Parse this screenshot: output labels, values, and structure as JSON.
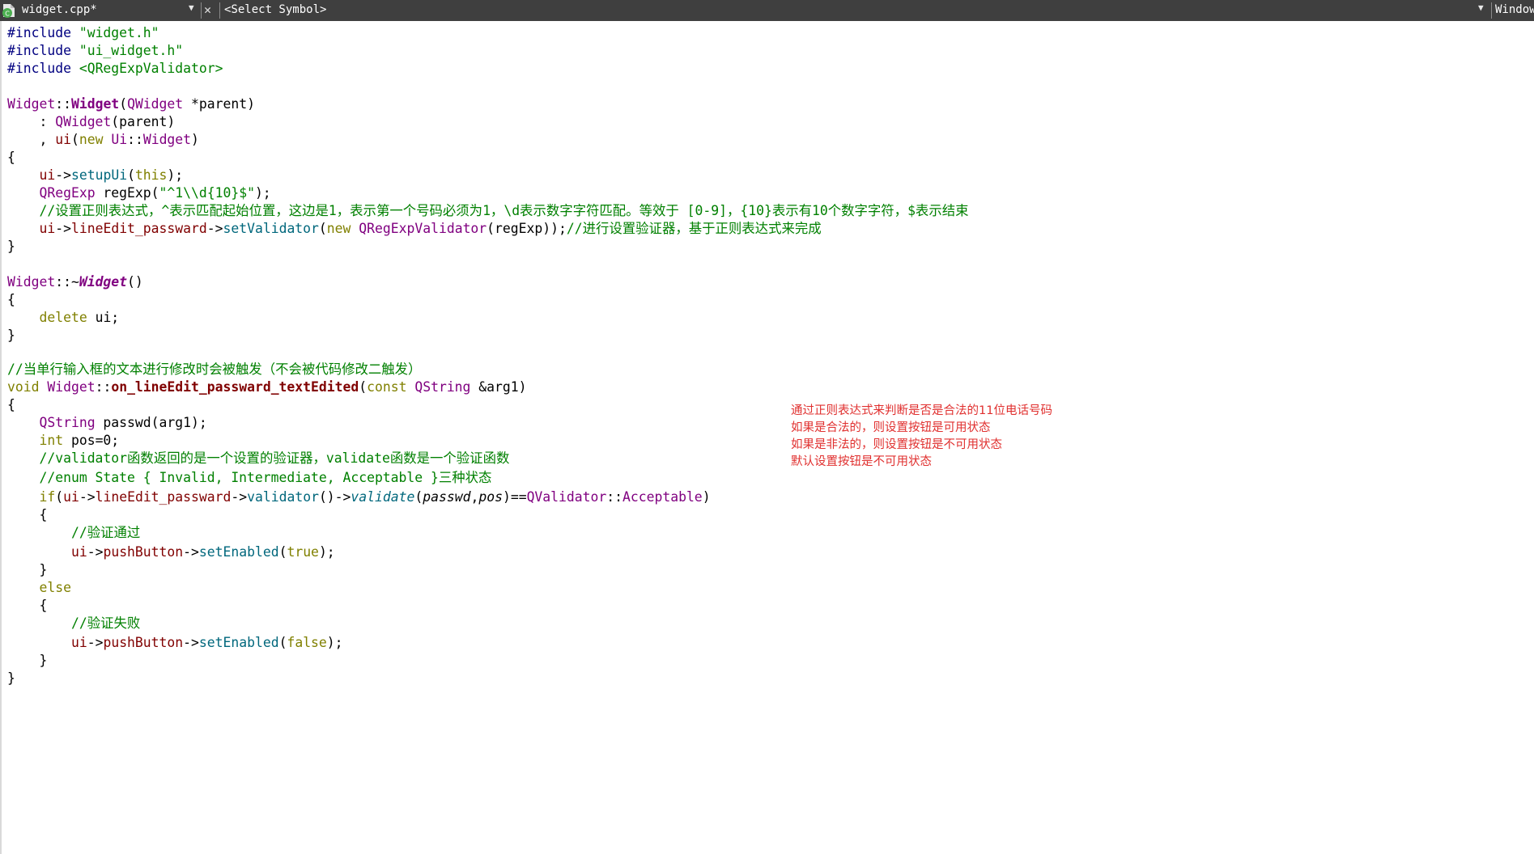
{
  "toolbar": {
    "file_name": "widget.cpp*",
    "symbol": "<Select Symbol>",
    "window_label": "Window"
  },
  "code": {
    "l1": {
      "directive": "#include",
      "file": "\"widget.h\""
    },
    "l2": {
      "directive": "#include",
      "file": "\"ui_widget.h\""
    },
    "l3": {
      "directive": "#include",
      "file": "<QRegExpValidator>"
    },
    "l5": {
      "class1": "Widget",
      "scope": "::",
      "ctor": "Widget",
      "open": "(",
      "ptype": "QWidget",
      "param": " *parent",
      "close": ")"
    },
    "l6": {
      "indent": "    : ",
      "base": "QWidget",
      "args": "(parent)"
    },
    "l7": {
      "indent": "    , ",
      "member": "ui",
      "open": "(",
      "kw_new": "new",
      "ns": "Ui",
      "scope": "::",
      "cls": "Widget",
      "close": ")"
    },
    "l8": {
      "text": "{"
    },
    "l9": {
      "indent": "    ",
      "ui": "ui",
      "arrow": "->",
      "fn": "setupUi",
      "open": "(",
      "kw_this": "this",
      "close": ");"
    },
    "l10": {
      "indent": "    ",
      "type": "QRegExp",
      "var": " regExp(",
      "string": "\"^1\\\\d{10}$\"",
      "close": ");"
    },
    "l11": {
      "indent": "    ",
      "comment": "//设置正则表达式，^表示匹配起始位置，这边是1，表示第一个号码必须为1，\\d表示数字字符匹配。等效于 [0-9]，{10}表示有10个数字字符，$表示结束"
    },
    "l12": {
      "indent": "    ",
      "ui": "ui",
      "arrow": "->",
      "member": "lineEdit_passward",
      "arrow2": "->",
      "fn": "setValidator",
      "open": "(",
      "kw_new": "new",
      "sp": " ",
      "cls": "QRegExpValidator",
      "args": "(regExp));",
      "comment": "//进行设置验证器，基于正则表达式来完成"
    },
    "l13": {
      "text": "}"
    },
    "l15": {
      "class1": "Widget",
      "scope": "::~",
      "dtor": "Widget",
      "parens": "()"
    },
    "l16": {
      "text": "{"
    },
    "l17": {
      "indent": "    ",
      "kw_delete": "delete",
      "rest": " ui;"
    },
    "l18": {
      "text": "}"
    },
    "l20": {
      "comment": "//当单行输入框的文本进行修改时会被触发（不会被代码修改二触发）"
    },
    "l21": {
      "kw_void": "void",
      "sp": " ",
      "class1": "Widget",
      "scope": "::",
      "fn": "on_lineEdit_passward_textEdited",
      "open": "(",
      "kw_const": "const",
      "sp2": " ",
      "type": "QString",
      "param": " &arg1)"
    },
    "l22": {
      "text": "{"
    },
    "l23": {
      "indent": "    ",
      "type": "QString",
      "rest": " passwd(arg1);"
    },
    "l24": {
      "indent": "    ",
      "kw_int": "int",
      "rest": " pos=0;"
    },
    "l25": {
      "indent": "    ",
      "comment": "//validator函数返回的是一个设置的验证器，validate函数是一个验证函数"
    },
    "l26": {
      "indent": "    ",
      "comment": "//enum State { Invalid, Intermediate, Acceptable }三种状态"
    },
    "l27": {
      "indent": "    ",
      "kw_if": "if",
      "open": "(",
      "ui": "ui",
      "arrow": "->",
      "member": "lineEdit_passward",
      "arrow2": "->",
      "fn": "validator",
      "call": "()->",
      "fn2": "validate",
      "open2": "(",
      "arg1": "passwd",
      "comma": ",",
      "arg2": "pos",
      "eq": ")==",
      "cls": "QValidator",
      "scope": "::",
      "enum": "Acceptable",
      "close": ")"
    },
    "l28": {
      "text": "    {"
    },
    "l29": {
      "indent": "        ",
      "comment": "//验证通过"
    },
    "l30": {
      "indent": "        ",
      "ui": "ui",
      "arrow": "->",
      "member": "pushButton",
      "arrow2": "->",
      "fn": "setEnabled",
      "open": "(",
      "kw_bool": "true",
      "close": ");"
    },
    "l31": {
      "text": "    }"
    },
    "l32": {
      "indent": "    ",
      "kw_else": "else"
    },
    "l33": {
      "text": "    {"
    },
    "l34": {
      "indent": "        ",
      "comment": "//验证失败"
    },
    "l35": {
      "indent": "        ",
      "ui": "ui",
      "arrow": "->",
      "member": "pushButton",
      "arrow2": "->",
      "fn": "setEnabled",
      "open": "(",
      "kw_bool": "false",
      "close": ");"
    },
    "l36": {
      "text": "    }"
    },
    "l37": {
      "text": "}"
    }
  },
  "annotation": {
    "line1": "通过正则表达式来判断是否是合法的11位电话号码",
    "line2": "如果是合法的，则设置按钮是可用状态",
    "line3": "如果是非法的，则设置按钮是不可用状态",
    "line4": "默认设置按钮是不可用状态"
  },
  "colors": {
    "toolbar_bg": "#3f3f3f",
    "preprocessor": "#000080",
    "string": "#008000",
    "class": "#800080",
    "keyword": "#808000",
    "function": "#00677c",
    "member": "#800000",
    "comment": "#008000",
    "annotation": "#e0302f"
  }
}
